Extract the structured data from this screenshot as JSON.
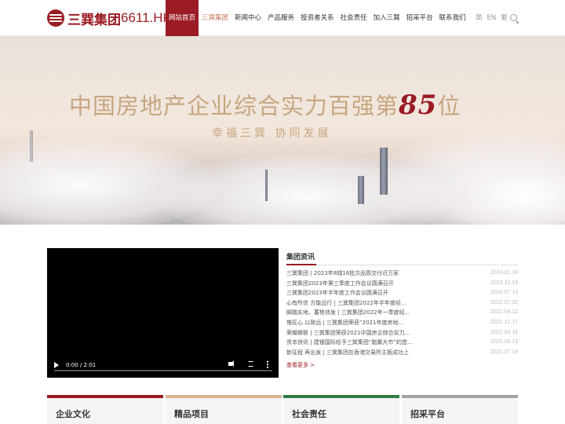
{
  "header": {
    "logo_text": "三巽集团",
    "logo_code": "6611.HK",
    "nav": [
      {
        "label": "网站首页",
        "state": "active"
      },
      {
        "label": "三巽集团",
        "state": "highlight"
      },
      {
        "label": "新闻中心",
        "state": "normal"
      },
      {
        "label": "产品服务",
        "state": "normal"
      },
      {
        "label": "投资者关系",
        "state": "normal"
      },
      {
        "label": "社会责任",
        "state": "normal"
      },
      {
        "label": "加入三巽",
        "state": "normal"
      },
      {
        "label": "招采平台",
        "state": "normal"
      },
      {
        "label": "联系我们",
        "state": "normal"
      }
    ],
    "languages": [
      "简",
      "EN",
      "繁"
    ],
    "search_icon": "search-icon"
  },
  "banner": {
    "title_prefix": "中国房地产企业综合实力百强第",
    "title_number": "85",
    "title_suffix": "位",
    "subtitle": "幸福三巽  协同发展"
  },
  "video": {
    "time": "0:00 / 2:01"
  },
  "news": {
    "title": "集团资讯",
    "items": [
      {
        "text": "三巽集团丨2023年8城16批次品质交付近万家",
        "date": "2024.01.19"
      },
      {
        "text": "三巽集团2023年第三季度工作会议圆满召开",
        "date": "2023.10.19"
      },
      {
        "text": "三巽集团2023年半年度工作会议圆满召开",
        "date": "2020.07.13"
      },
      {
        "text": "心有所信 方能远行 | 三巽集团2022年半年度经...",
        "date": "2022.07.20"
      },
      {
        "text": "脚踏实地、蓄势待发 | 三巽集团2022年一季度经...",
        "date": "2022.04.12"
      },
      {
        "text": "惟匠心 以致远 | 三巽集团荣获“2021年度房地...",
        "date": "2021.12.17"
      },
      {
        "text": "荣耀蝉联 | 三巽集团荣获2021中国房企综合实力...",
        "date": "2021.09.16"
      },
      {
        "text": "资本快讯 | 建银国际给予三巽集团“跑赢大市”的首...",
        "date": "2021.09.13"
      },
      {
        "text": "新征程 再出发 | 三巽集团在香港交易所主板成功上",
        "date": "2021.07.19"
      }
    ],
    "more": "查看更多 >"
  },
  "cards": [
    {
      "label": "企业文化",
      "color": "#9b1c24"
    },
    {
      "label": "精品项目",
      "color": "#d9b48f"
    },
    {
      "label": "社会责任",
      "color": "#2f7a45"
    },
    {
      "label": "招采平台",
      "color": "#a3a3a3"
    }
  ]
}
